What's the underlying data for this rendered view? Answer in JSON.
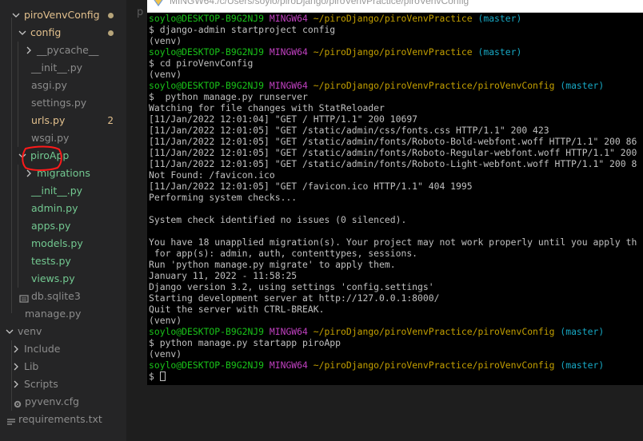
{
  "explorer": {
    "items": [
      {
        "label": "piroVenvConfig",
        "kind": "folder",
        "open": true,
        "color": "#e2c08d",
        "dot": true
      },
      {
        "label": "config",
        "kind": "folder",
        "open": true,
        "color": "#e2c08d",
        "dot": true
      },
      {
        "label": "__pycache__",
        "kind": "folder",
        "open": false,
        "color": "#8c8c8c"
      },
      {
        "label": "__init__.py",
        "kind": "py",
        "color": "#8c8c8c"
      },
      {
        "label": "asgi.py",
        "kind": "py",
        "color": "#8c8c8c"
      },
      {
        "label": "settings.py",
        "kind": "py",
        "color": "#8c8c8c"
      },
      {
        "label": "urls.py",
        "kind": "py",
        "color": "#e2c08d",
        "badge": "2"
      },
      {
        "label": "wsgi.py",
        "kind": "py",
        "color": "#8c8c8c"
      },
      {
        "label": "piroApp",
        "kind": "folder",
        "open": true,
        "color": "#73c991"
      },
      {
        "label": "migrations",
        "kind": "folder",
        "open": false,
        "color": "#73c991"
      },
      {
        "label": "__init__.py",
        "kind": "py",
        "color": "#73c991"
      },
      {
        "label": "admin.py",
        "kind": "py",
        "color": "#73c991"
      },
      {
        "label": "apps.py",
        "kind": "py",
        "color": "#73c991"
      },
      {
        "label": "models.py",
        "kind": "py",
        "color": "#73c991"
      },
      {
        "label": "tests.py",
        "kind": "py",
        "color": "#73c991"
      },
      {
        "label": "views.py",
        "kind": "py",
        "color": "#73c991"
      },
      {
        "label": "db.sqlite3",
        "kind": "db",
        "color": "#8c8c8c"
      },
      {
        "label": "manage.py",
        "kind": "py",
        "color": "#8c8c8c"
      },
      {
        "label": "venv",
        "kind": "folder",
        "open": true,
        "color": "#8c8c8c"
      },
      {
        "label": "Include",
        "kind": "folder",
        "open": false,
        "color": "#8c8c8c"
      },
      {
        "label": "Lib",
        "kind": "folder",
        "open": false,
        "color": "#8c8c8c"
      },
      {
        "label": "Scripts",
        "kind": "folder",
        "open": false,
        "color": "#8c8c8c"
      },
      {
        "label": "pyvenv.cfg",
        "kind": "cfg",
        "color": "#8c8c8c"
      },
      {
        "label": "requirements.txt",
        "kind": "txt",
        "color": "#8c8c8c"
      }
    ]
  },
  "editor": {
    "tab_hint": "p"
  },
  "terminal": {
    "title": "MINGW64:/c/Users/soylo/piroDjango/piroVenvPractice/piroVenvConfig",
    "user": "soylo@DESKTOP-B9G2NJ9",
    "shell": "MINGW64",
    "lines": [
      {
        "type": "prompt",
        "path": "~/piroDjango/piroVenvPractice",
        "branch": "(master)"
      },
      {
        "type": "text",
        "text": "$ django-admin startproject config"
      },
      {
        "type": "text",
        "text": "(venv)"
      },
      {
        "type": "prompt",
        "path": "~/piroDjango/piroVenvPractice",
        "branch": "(master)"
      },
      {
        "type": "text",
        "text": "$ cd piroVenvConfig"
      },
      {
        "type": "text",
        "text": "(venv)"
      },
      {
        "type": "prompt",
        "path": "~/piroDjango/piroVenvPractice/piroVenvConfig",
        "branch": "(master)"
      },
      {
        "type": "text",
        "text": "$  python manage.py runserver"
      },
      {
        "type": "text",
        "text": "Watching for file changes with StatReloader"
      },
      {
        "type": "text",
        "text": "[11/Jan/2022 12:01:04] \"GET / HTTP/1.1\" 200 10697"
      },
      {
        "type": "text",
        "text": "[11/Jan/2022 12:01:05] \"GET /static/admin/css/fonts.css HTTP/1.1\" 200 423"
      },
      {
        "type": "text",
        "text": "[11/Jan/2022 12:01:05] \"GET /static/admin/fonts/Roboto-Bold-webfont.woff HTTP/1.1\" 200 86"
      },
      {
        "type": "text",
        "text": "[11/Jan/2022 12:01:05] \"GET /static/admin/fonts/Roboto-Regular-webfont.woff HTTP/1.1\" 200"
      },
      {
        "type": "text",
        "text": "[11/Jan/2022 12:01:05] \"GET /static/admin/fonts/Roboto-Light-webfont.woff HTTP/1.1\" 200 8"
      },
      {
        "type": "text",
        "text": "Not Found: /favicon.ico"
      },
      {
        "type": "text",
        "text": "[11/Jan/2022 12:01:05] \"GET /favicon.ico HTTP/1.1\" 404 1995"
      },
      {
        "type": "text",
        "text": "Performing system checks..."
      },
      {
        "type": "text",
        "text": ""
      },
      {
        "type": "text",
        "text": "System check identified no issues (0 silenced)."
      },
      {
        "type": "text",
        "text": ""
      },
      {
        "type": "text",
        "text": "You have 18 unapplied migration(s). Your project may not work properly until you apply th"
      },
      {
        "type": "text",
        "text": " for app(s): admin, auth, contenttypes, sessions."
      },
      {
        "type": "text",
        "text": "Run 'python manage.py migrate' to apply them."
      },
      {
        "type": "text",
        "text": "January 11, 2022 - 11:58:25"
      },
      {
        "type": "text",
        "text": "Django version 3.2, using settings 'config.settings'"
      },
      {
        "type": "text",
        "text": "Starting development server at http://127.0.0.1:8000/"
      },
      {
        "type": "text",
        "text": "Quit the server with CTRL-BREAK."
      },
      {
        "type": "text",
        "text": "(venv)"
      },
      {
        "type": "prompt",
        "path": "~/piroDjango/piroVenvPractice/piroVenvConfig",
        "branch": "(master)"
      },
      {
        "type": "text",
        "text": "$ python manage.py startapp piroApp"
      },
      {
        "type": "text",
        "text": "(venv)"
      },
      {
        "type": "prompt",
        "path": "~/piroDjango/piroVenvPractice/piroVenvConfig",
        "branch": "(master)"
      },
      {
        "type": "cursor",
        "text": "$ "
      }
    ]
  },
  "annotation": {
    "color": "#ff1a1a",
    "target": "piroApp"
  }
}
